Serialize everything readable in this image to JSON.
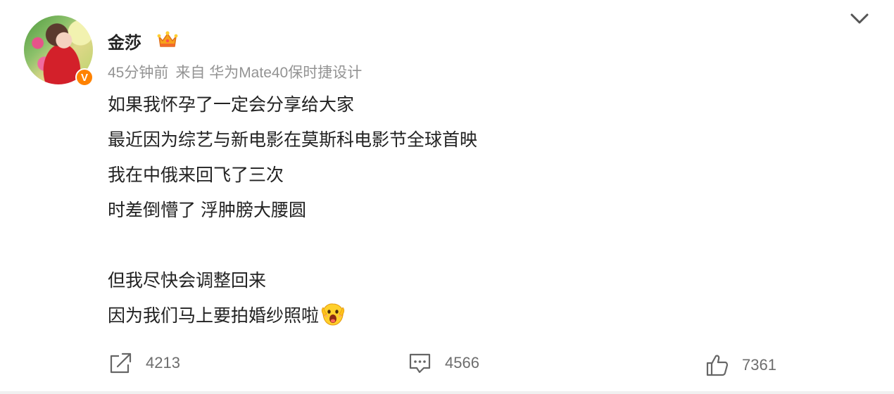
{
  "post": {
    "author": {
      "name": "金莎",
      "verified_badge": "V",
      "avatar": "avatar-photo"
    },
    "meta": {
      "time": "45分钟前",
      "source": "来自 华为Mate40保时捷设计"
    },
    "content": {
      "lines": [
        "如果我怀孕了一定会分享给大家",
        "最近因为综艺与新电影在莫斯科电影节全球首映",
        "我在中俄来回飞了三次",
        "时差倒懵了 浮肿膀大腰圆",
        "",
        "但我尽快会调整回来",
        "因为我们马上要拍婚纱照啦"
      ],
      "emoji": "excited-face-emoji"
    },
    "actions": {
      "repost_count": "4213",
      "comment_count": "4566",
      "like_count": "7361"
    },
    "icons": {
      "menu": "chevron-down-icon",
      "crown": "crown-icon",
      "repost": "repost-icon",
      "comment": "comment-icon",
      "like": "thumbs-up-icon"
    },
    "colors": {
      "badge": "#ff8200",
      "meta_text": "#939393",
      "action_text": "#6d6d6d"
    }
  }
}
